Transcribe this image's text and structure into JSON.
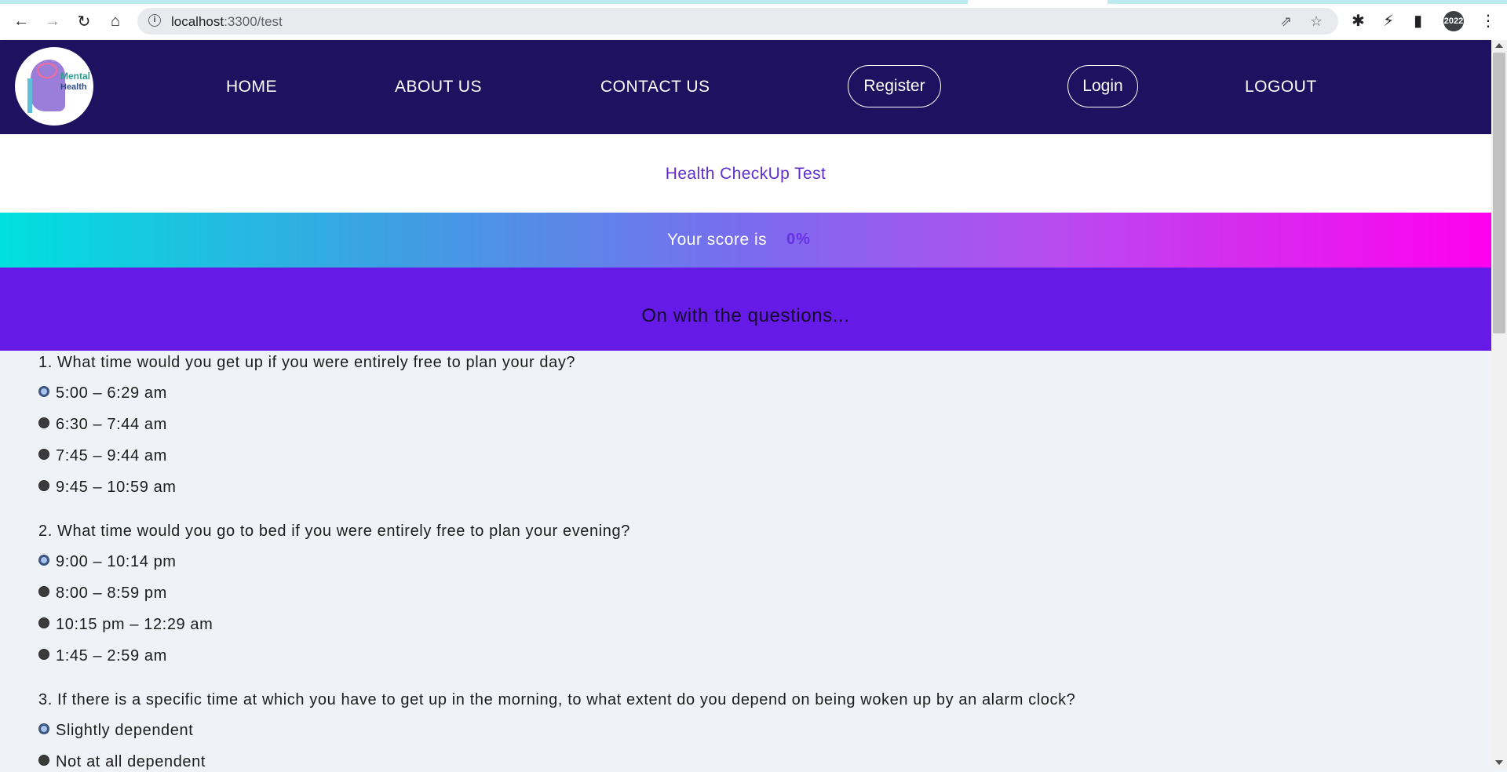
{
  "browser": {
    "url_host": "localhost",
    "url_path": ":3300/test",
    "profile_label": "2022",
    "icons": [
      "back-icon",
      "forward-icon",
      "reload-icon",
      "home-icon",
      "info-icon",
      "share-icon",
      "star-icon",
      "extensions-icon",
      "sync-icon",
      "sidebar-icon",
      "menu-icon"
    ]
  },
  "navbar": {
    "logo_text_line1": "Mental",
    "logo_text_line2": "Health",
    "links": [
      "HOME",
      "ABOUT US",
      "CONTACT US"
    ],
    "register": "Register",
    "login": "Login",
    "logout": "LOGOUT",
    "background": "#1d1160"
  },
  "page": {
    "title": "Health CheckUp Test",
    "score_label": "Your score is",
    "score_value": "0%",
    "questions_heading": "On with the questions..."
  },
  "questions": [
    {
      "text": "1. What time would you get up if you were entirely free to plan your day?",
      "options": [
        "5:00 – 6:29 am",
        "6:30 – 7:44 am",
        "7:45 – 9:44 am",
        "9:45 – 10:59 am"
      ],
      "selected": 0
    },
    {
      "text": "2. What time would you go to bed if you were entirely free to plan your evening?",
      "options": [
        "9:00 – 10:14 pm",
        "8:00 – 8:59 pm",
        "10:15 pm – 12:29 am",
        "1:45 – 2:59 am"
      ],
      "selected": 0
    },
    {
      "text": "3. If there is a specific time at which you have to get up in the morning, to what extent do you depend on being woken up by an alarm clock?",
      "options": [
        "Slightly dependent",
        "Not at all dependent"
      ],
      "selected": 0
    }
  ],
  "colors": {
    "accent_purple": "#651ae7",
    "title_purple": "#5e2ccf",
    "gradient_start": "#00e0df",
    "gradient_end": "#ff00ee"
  }
}
